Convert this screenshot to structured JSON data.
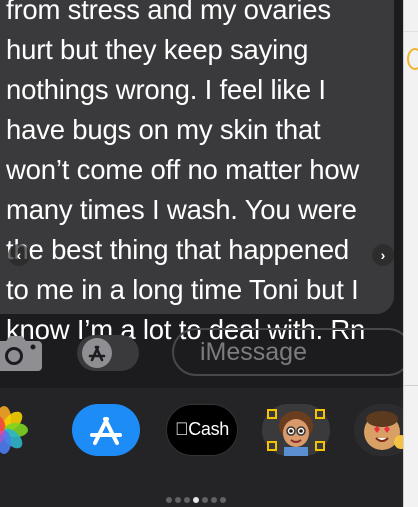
{
  "message": {
    "text": "from stress and my ovaries\nhurt but they keep saying\nnothings wrong. I feel like I\nhave bugs on my skin that\nwon’t come off no matter how\nmany times I wash. You were\nthe best thing that happened\nto me in a long time Toni but I\nknow I’m a lot to deal with. Rn"
  },
  "input": {
    "placeholder": "iMessage"
  },
  "apps": {
    "cash_label": "Cash",
    "items": [
      "photos-icon",
      "app-store-icon",
      "apple-cash-icon",
      "memoji-icon",
      "emoji-stickers-icon"
    ]
  },
  "page_dots": {
    "count": 7,
    "active_index": 3
  },
  "colors": {
    "bubble": "#3a3a3c",
    "app_store_blue": "#1d8cf6",
    "background": "#1c1c1e"
  }
}
